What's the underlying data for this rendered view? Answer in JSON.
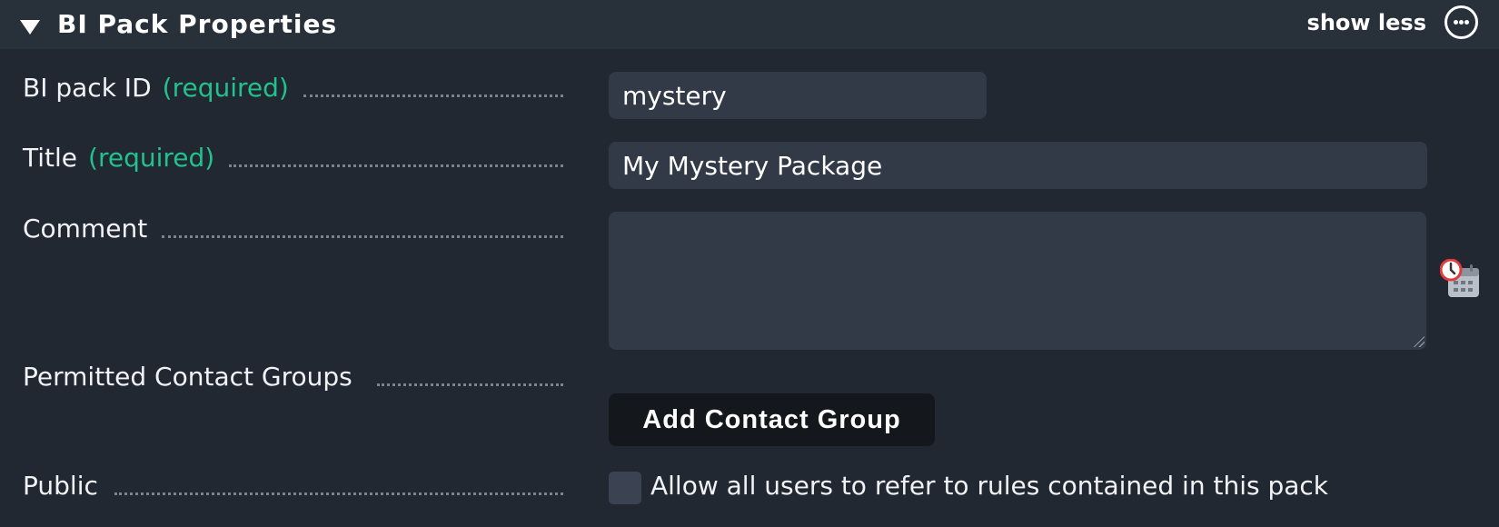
{
  "section": {
    "title": "BI Pack Properties",
    "show_less_label": "show less"
  },
  "fields": {
    "pack_id": {
      "label": "BI pack ID",
      "required": "(required)",
      "value": "mystery"
    },
    "title": {
      "label": "Title",
      "required": "(required)",
      "value": "My Mystery Package"
    },
    "comment": {
      "label": "Comment",
      "value": ""
    },
    "contact_groups": {
      "label": "Permitted Contact Groups",
      "button_label": "Add Contact Group"
    },
    "public": {
      "label": "Public",
      "checkbox_label": "Allow all users to refer to rules contained in this pack",
      "checked": false
    }
  },
  "icons": {
    "collapse": "triangle-down-icon",
    "more": "ellipsis-circle-icon",
    "calendar": "calendar-clock-icon"
  },
  "colors": {
    "background": "#222831",
    "header": "#283039",
    "input": "#323a48",
    "required": "#21c28e",
    "button": "#14171c"
  }
}
